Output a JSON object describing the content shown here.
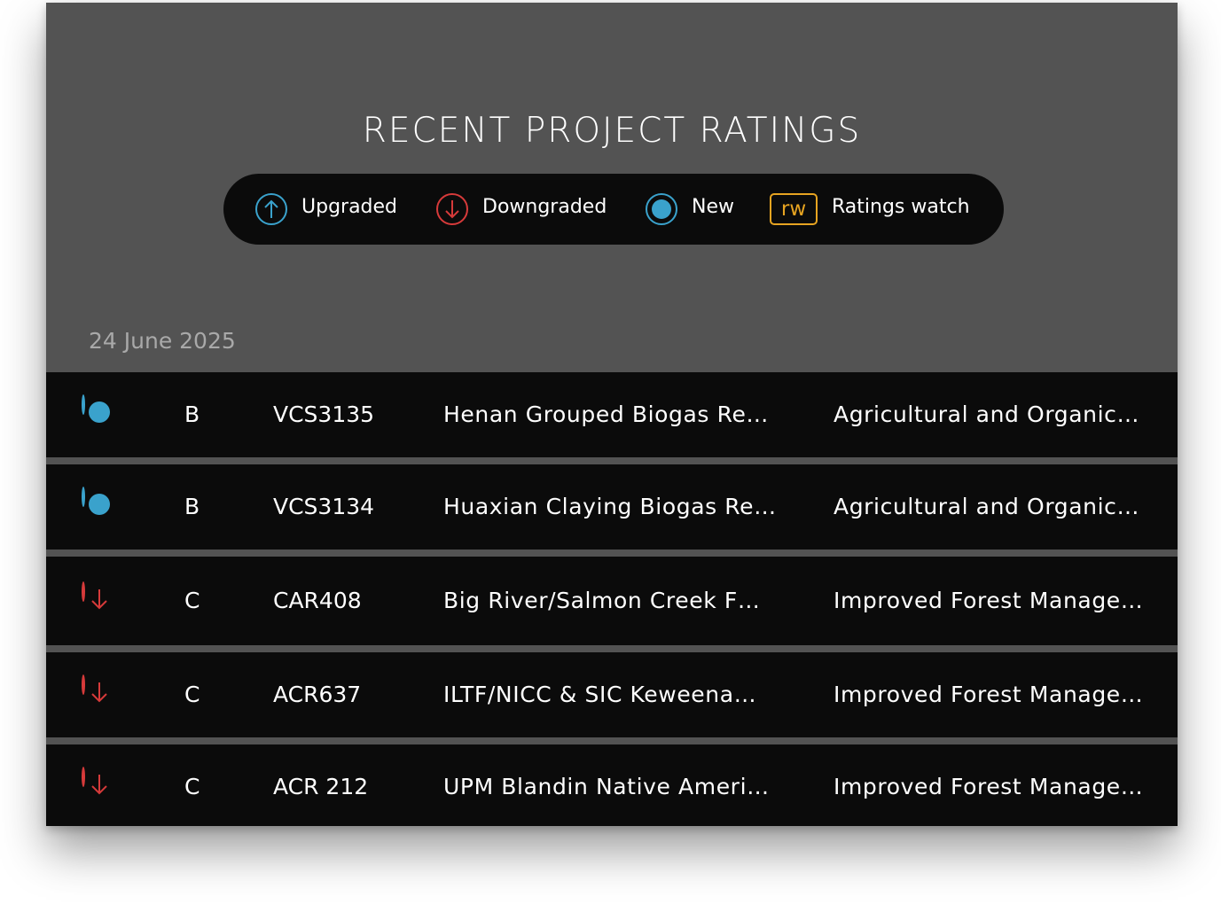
{
  "title": "RECENT PROJECT RATINGS",
  "legend": {
    "upgraded": "Upgraded",
    "downgraded": "Downgraded",
    "new": "New",
    "rw_badge": "rw",
    "ratings_watch": "Ratings watch"
  },
  "colors": {
    "upgraded": "#3aa2cc",
    "downgraded": "#d63a3a",
    "new": "#3aa2cc",
    "watch": "#e7a421"
  },
  "date": "24 June 2025",
  "rows": [
    {
      "status": "new",
      "rating": "B",
      "id": "VCS3135",
      "name": "Henan Grouped Biogas Re…",
      "category": "Agricultural and Organic…"
    },
    {
      "status": "new",
      "rating": "B",
      "id": "VCS3134",
      "name": "Huaxian Claying Biogas Re…",
      "category": "Agricultural and Organic…"
    },
    {
      "status": "downgraded",
      "rating": "C",
      "id": "CAR408",
      "name": "Big River/Salmon Creek F…",
      "category": "Improved Forest Manage…"
    },
    {
      "status": "downgraded",
      "rating": "C",
      "id": "ACR637",
      "name": "ILTF/NICC & SIC Keweena…",
      "category": "Improved Forest Manage…"
    },
    {
      "status": "downgraded",
      "rating": "C",
      "id": "ACR 212",
      "name": "UPM Blandin Native Ameri…",
      "category": "Improved Forest Manage…"
    }
  ]
}
